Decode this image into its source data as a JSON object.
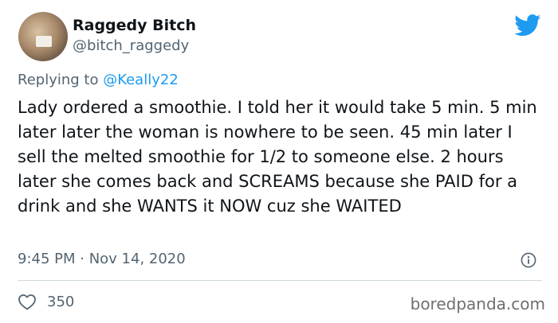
{
  "author": {
    "name": "Raggedy Bitch",
    "handle": "@bitch_raggedy"
  },
  "reply": {
    "prefix": "Replying to ",
    "mention": "@Keally22"
  },
  "tweet": {
    "text": "Lady ordered a smoothie. I told her it would take 5 min. 5 min later later the woman is nowhere to be seen. 45 min later I sell the melted smoothie for 1/2 to someone else. 2 hours later she comes back and SCREAMS because she PAID for a drink and she WANTS it NOW cuz she WAITED",
    "timestamp": "9:45 PM · Nov 14, 2020"
  },
  "stats": {
    "likes": "350"
  },
  "watermark": "boredpanda.com",
  "icons": {
    "logo": "twitter-bird-icon",
    "info": "info-icon",
    "like": "heart-icon"
  },
  "colors": {
    "twitter_blue": "#1d9bf0",
    "secondary_text": "#536471"
  }
}
